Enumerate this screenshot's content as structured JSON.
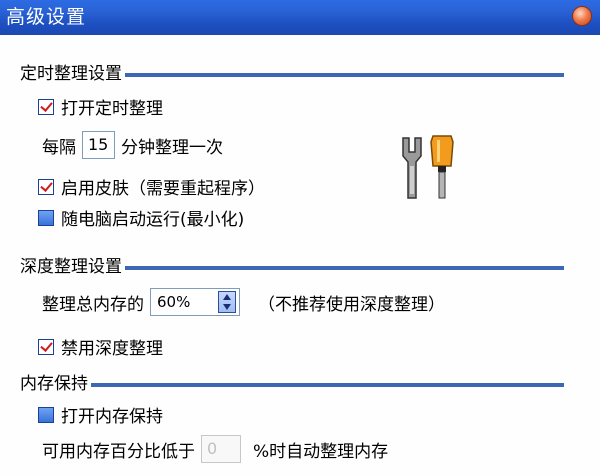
{
  "window": {
    "title": "高级设置"
  },
  "sections": {
    "timer": {
      "title": "定时整理设置",
      "enable_timer_label": "打开定时整理",
      "interval_prefix": "每隔",
      "interval_value": "15",
      "interval_suffix": "分钟整理一次",
      "enable_skin_label": "启用皮肤（需要重起程序）",
      "startup_label": "随电脑启动运行(最小化)"
    },
    "deep": {
      "title": "深度整理设置",
      "total_memory_label": "整理总内存的",
      "total_memory_value": "60%",
      "note": "（不推荐使用深度整理）",
      "disable_deep_label": "禁用深度整理"
    },
    "keep": {
      "title": "内存保持",
      "enable_keep_label": "打开内存保持",
      "threshold_prefix": "可用内存百分比低于",
      "threshold_value": "0",
      "threshold_suffix": "%时自动整理内存"
    }
  },
  "states": {
    "enable_timer": true,
    "enable_skin": true,
    "startup": false,
    "disable_deep": true,
    "enable_keep": false
  },
  "colors": {
    "titlebar": "#2a63d6",
    "section_line": "#3b67b5",
    "checkmark": "#d21a1a"
  },
  "icons": {
    "tools": "wrench-screwdriver-icon",
    "close": "close-icon"
  }
}
